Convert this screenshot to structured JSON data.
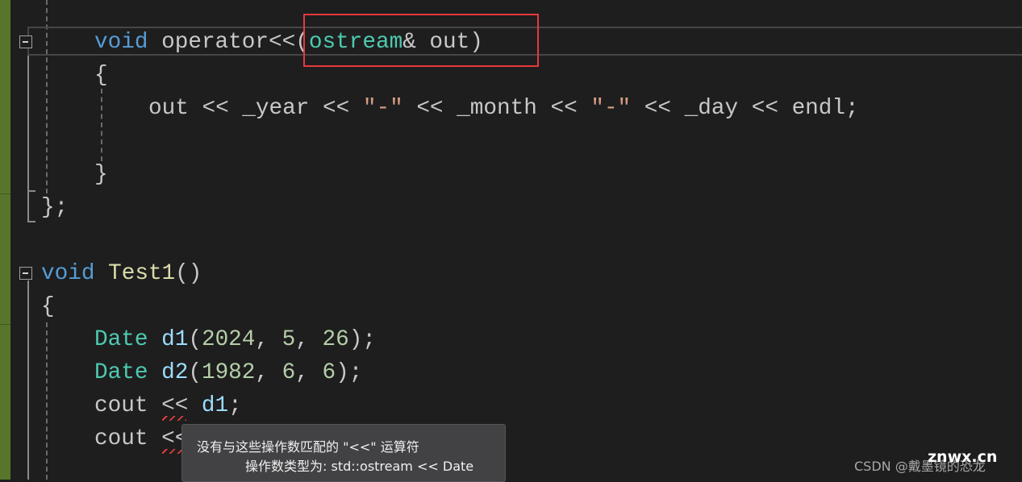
{
  "editor": {
    "lines": {
      "l1": {
        "kw": "void",
        "fn": "operator<<(",
        "ty": "ostream",
        "rest": "& out)"
      },
      "l2": "{",
      "l3": {
        "a": "out << _year << ",
        "s1": "\"-\"",
        "b": " << _month << ",
        "s2": "\"-\"",
        "c": " << _day << endl;"
      },
      "l5": "}",
      "l6": "};",
      "l8": {
        "kw": "void",
        "fn": "Test1",
        "rest": "()"
      },
      "l9": "{",
      "l10": {
        "ty": "Date",
        "va": "d1",
        "p1": "(",
        "n1": "2024",
        "c1": ", ",
        "n2": "5",
        "c2": ", ",
        "n3": "26",
        "p2": ");"
      },
      "l11": {
        "ty": "Date",
        "va": "d2",
        "p1": "(",
        "n1": "1982",
        "c1": ", ",
        "n2": "6",
        "c2": ", ",
        "n3": "6",
        "p2": ");"
      },
      "l12": {
        "a": "cout << ",
        "va": "d1",
        "b": ";"
      },
      "l13": "cout <<"
    }
  },
  "tooltip": {
    "line1": "没有与这些操作数匹配的 \"<<\" 运算符",
    "line2": "操作数类型为:  std::ostream << Date"
  },
  "watermark": {
    "csdn": "CSDN @戴墨镜的恐龙",
    "site": "znwx.cn"
  },
  "colors": {
    "background": "#1e1e1e",
    "keyword": "#569cd6",
    "type": "#4ec9b0",
    "highlight_box": "#e8383d",
    "error_squiggle": "#e03c3c"
  }
}
